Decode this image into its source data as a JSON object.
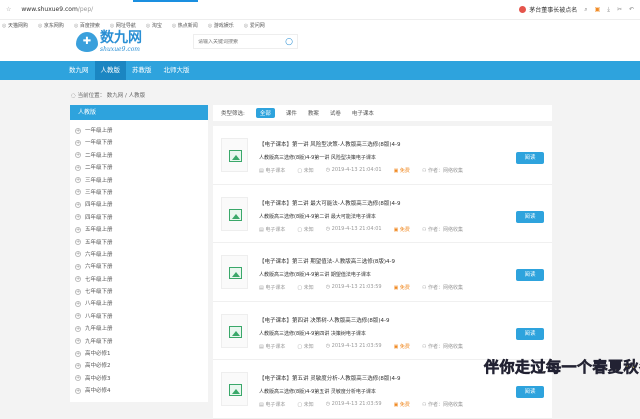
{
  "browser": {
    "url_host": "www.shuxue9.com",
    "url_path": "/pep/",
    "hot_search": "茅台董事长被点名",
    "bookmarks": [
      "天猫网购",
      "京东网购",
      "百度搜索",
      "网址导航",
      "淘宝",
      "热点新闻",
      "游戏娱乐",
      "爱问网"
    ]
  },
  "site": {
    "logo_cn": "数九网",
    "logo_en": "shuxue9.com",
    "search_placeholder": "请输入关键词搜索",
    "nav": [
      "数九网",
      "人教版",
      "苏教版",
      "北师大版"
    ],
    "nav_active": 1,
    "breadcrumb": "当前位置： 数九网 / 人教版"
  },
  "sidebar": {
    "title": "人教版",
    "items": [
      "一年级上册",
      "一年级下册",
      "二年级上册",
      "二年级下册",
      "三年级上册",
      "三年级下册",
      "四年级上册",
      "四年级下册",
      "五年级上册",
      "五年级下册",
      "六年级上册",
      "六年级下册",
      "七年级上册",
      "七年级下册",
      "八年级上册",
      "八年级下册",
      "九年级上册",
      "九年级下册",
      "高中必修1",
      "高中必修2",
      "高中必修3",
      "高中必修4"
    ]
  },
  "filter": {
    "label": "类型筛选:",
    "options": [
      "全部",
      "课件",
      "教案",
      "试卷",
      "电子课本"
    ],
    "selected": 0
  },
  "items": [
    {
      "title": "【电子课本】第一讲 风险型决策-人教版高三选修(8版)4-9",
      "desc": "人教版高三选修(8版)4-9第一讲 风险型决策电子课本",
      "type": "电子课本",
      "size": "未知",
      "date": "2019-4-13 21:04:01",
      "price": "免费",
      "author": "作者：网络收集",
      "button": "阅读"
    },
    {
      "title": "【电子课本】第二讲 最大可能法-人教版高三选修(8版)4-9",
      "desc": "人教版高三选修(8版)4-9第二讲 最大可能法电子课本",
      "type": "电子课本",
      "size": "未知",
      "date": "2019-4-13 21:04:01",
      "price": "免费",
      "author": "作者：网络收集",
      "button": "阅读"
    },
    {
      "title": "【电子课本】第三讲 期望值法-人教版高三选修(8版)4-9",
      "desc": "人教版高三选修(8版)4-9第三讲 期望值法电子课本",
      "type": "电子课本",
      "size": "未知",
      "date": "2019-4-13 21:03:59",
      "price": "免费",
      "author": "作者：网络收集",
      "button": "阅读"
    },
    {
      "title": "【电子课本】第四讲 决策树-人教版高三选修(8版)4-9",
      "desc": "人教版高三选修(8版)4-9第四讲 决策树电子课本",
      "type": "电子课本",
      "size": "未知",
      "date": "2019-4-13 21:03:59",
      "price": "免费",
      "author": "作者：网络收集",
      "button": "阅读"
    },
    {
      "title": "【电子课本】第五讲 灵敏度分析-人教版高三选修(8版)4-9",
      "desc": "人教版高三选修(8版)4-9第五讲 灵敏度分析电子课本",
      "type": "电子课本",
      "size": "未知",
      "date": "2019-4-13 21:03:59",
      "price": "免费",
      "author": "作者：网络收集",
      "button": "阅读"
    }
  ],
  "overlay_caption": "伴你走过每一个春夏秋冬"
}
